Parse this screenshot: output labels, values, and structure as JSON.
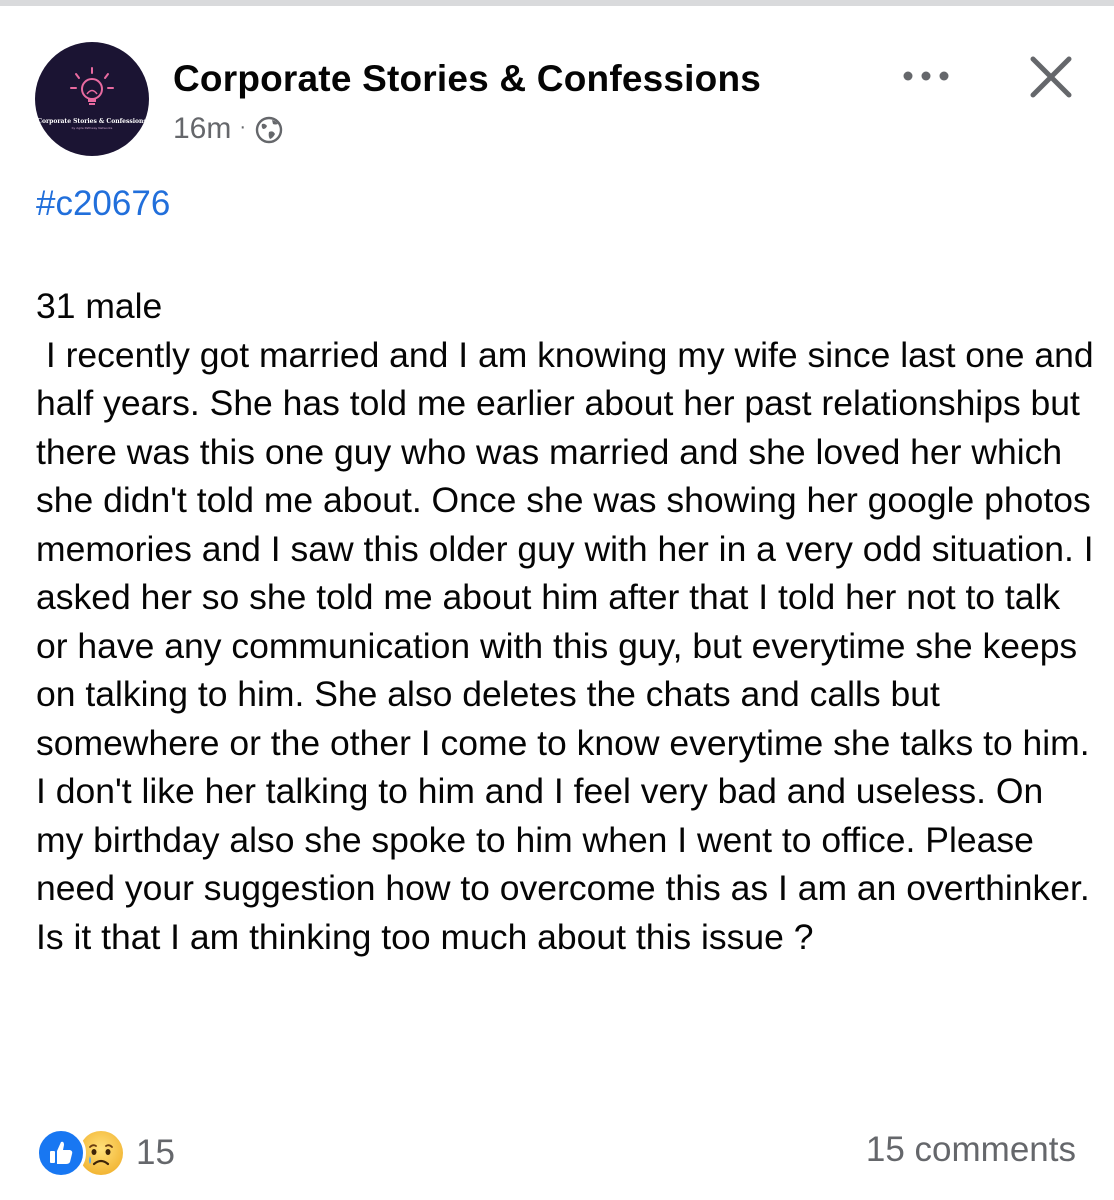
{
  "page": {
    "name": "Corporate Stories & Confessions",
    "time_ago": "16m",
    "separator": "·",
    "avatar_text": "Corporate Stories & Confessions",
    "avatar_subtext": "by Agile Pathway Networks"
  },
  "icons": {
    "globe": "globe-icon",
    "more": "more-icon",
    "close": "close-icon",
    "like": "like-icon",
    "sad": "sad-icon",
    "logo": "lightbulb-icon"
  },
  "post": {
    "hashtag": "#c20676",
    "text": "31 male\n I recently got married and I am knowing my wife since last one and half years. She has told me earlier about her past relationships but there was this one guy who was married and she loved her which she didn't told me about. Once she was showing her google photos memories and I saw this older guy with her in a very odd situation. I asked her so she told me about him after that I told her not to talk or have any communication with this guy, but everytime she keeps on talking to him. She also deletes the chats and calls but somewhere or the other I come to know everytime she talks to him. I don't like her talking to him and I feel very bad and useless. On my birthday also she spoke to him when I went to office. Please need your suggestion how to overcome this as I am an overthinker. Is it that I am thinking too much about this issue ?"
  },
  "footer": {
    "reaction_count": "15",
    "comments": "15 comments"
  },
  "colors": {
    "hashtag": "#216fdb",
    "like": "#1877f2",
    "muted": "#65676b",
    "avatar_bg": "#1b1433",
    "logo_accent": "#e86aa0"
  }
}
